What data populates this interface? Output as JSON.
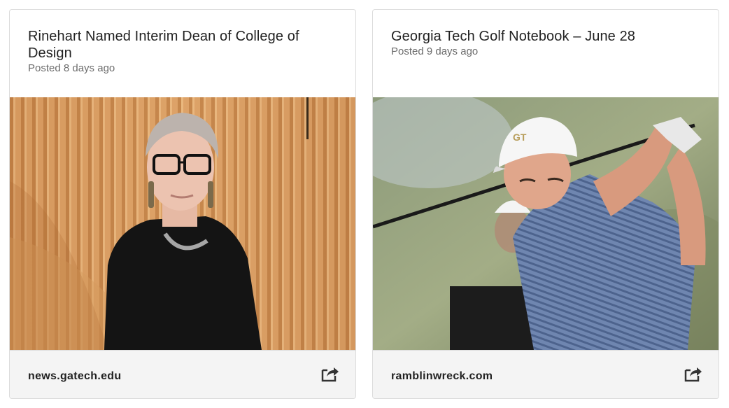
{
  "cards": [
    {
      "title": "Rinehart Named Interim Dean of College of Design",
      "posted": "Posted 8 days ago",
      "source": "news.gatech.edu",
      "image_subject": "portrait-woman-wood-slats",
      "share_icon": "share-icon"
    },
    {
      "title": "Georgia Tech Golf Notebook – June 28",
      "posted": "Posted 9 days ago",
      "source": "ramblinwreck.com",
      "image_subject": "golfer-swing",
      "share_icon": "share-icon"
    }
  ],
  "colors": {
    "title": "#222222",
    "meta": "#6c6c6c",
    "footer_bg": "#f4f4f4",
    "border": "#dcdcdc",
    "icon": "#333333"
  }
}
